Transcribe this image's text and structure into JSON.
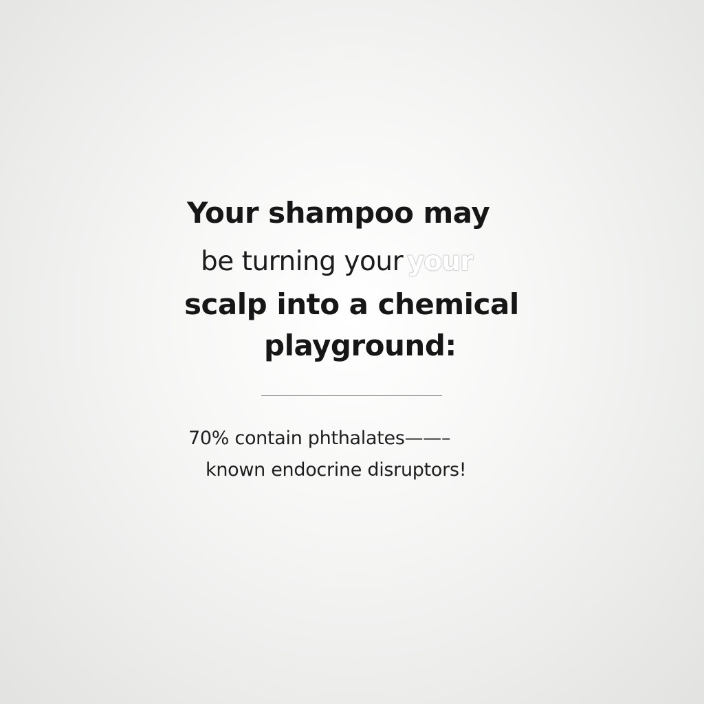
{
  "headline": {
    "line1": "Your shampoo may",
    "line2": "be turning your",
    "line2_ghost": "your",
    "line3": "scalp into a chemical",
    "line4": "playground:"
  },
  "stat": {
    "line1": "70% contain phthalates——–",
    "line2": "known endocrine disruptors!"
  },
  "colors": {
    "text": "#161616",
    "divider": "#8f8f8f",
    "background_center": "#ffffff",
    "background_edge": "#e2e3e0"
  }
}
